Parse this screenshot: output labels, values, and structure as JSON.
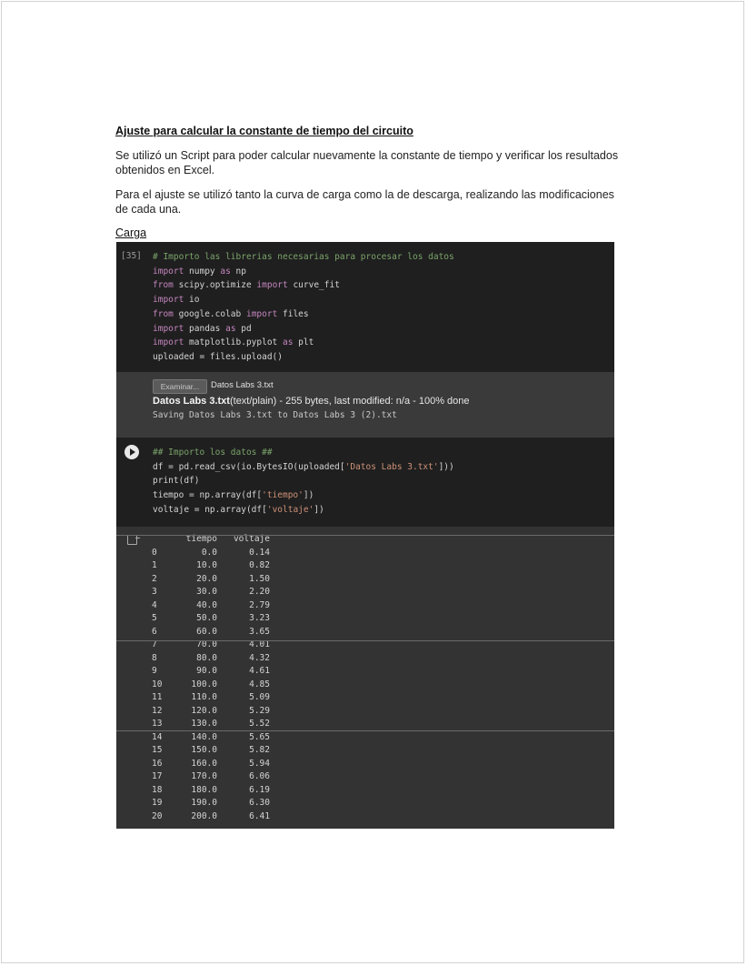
{
  "document": {
    "title": "Ajuste para calcular la constante de tiempo del circuito",
    "paragraph1": "Se utilizó un Script para poder calcular nuevamente la constante de tiempo y verificar los resultados obtenidos en Excel.",
    "paragraph2": "Para el ajuste se utilizó tanto la curva de carga como la de descarga, realizando las modificaciones de cada una.",
    "section_label": "Carga"
  },
  "notebook": {
    "cell1": {
      "execution_count": "[35]",
      "comment": "# Importo las librerias necesarias para procesar los datos",
      "lines": [
        "import numpy as np",
        "from scipy.optimize import curve_fit",
        "import io",
        "from google.colab import files",
        "import pandas as pd",
        "import matplotlib.pyplot as plt",
        "uploaded = files.upload()"
      ]
    },
    "upload_output": {
      "button_label": "Examinar...",
      "selected_file": "Datos Labs 3.txt",
      "status_name": "Datos Labs 3.txt",
      "status_detail": "(text/plain) - 255 bytes, last modified: n/a - 100% done",
      "saving_line": "Saving Datos Labs 3.txt to Datos Labs 3 (2).txt"
    },
    "cell2": {
      "comment": "## Importo los datos ##",
      "lines": [
        "df = pd.read_csv(io.BytesIO(uploaded['Datos Labs 3.txt']))",
        "print(df)",
        "tiempo = np.array(df['tiempo'])",
        "voltaje = np.array(df['voltaje'])"
      ]
    },
    "dataframe": {
      "columns": [
        "tiempo",
        "voltaje"
      ],
      "rows": [
        [
          "0",
          "0.0",
          "0.14"
        ],
        [
          "1",
          "10.0",
          "0.82"
        ],
        [
          "2",
          "20.0",
          "1.50"
        ],
        [
          "3",
          "30.0",
          "2.20"
        ],
        [
          "4",
          "40.0",
          "2.79"
        ],
        [
          "5",
          "50.0",
          "3.23"
        ],
        [
          "6",
          "60.0",
          "3.65"
        ],
        [
          "7",
          "70.0",
          "4.01"
        ],
        [
          "8",
          "80.0",
          "4.32"
        ],
        [
          "9",
          "90.0",
          "4.61"
        ],
        [
          "10",
          "100.0",
          "4.85"
        ],
        [
          "11",
          "110.0",
          "5.09"
        ],
        [
          "12",
          "120.0",
          "5.29"
        ],
        [
          "13",
          "130.0",
          "5.52"
        ],
        [
          "14",
          "140.0",
          "5.65"
        ],
        [
          "15",
          "150.0",
          "5.82"
        ],
        [
          "16",
          "160.0",
          "5.94"
        ],
        [
          "17",
          "170.0",
          "6.06"
        ],
        [
          "18",
          "180.0",
          "6.19"
        ],
        [
          "19",
          "190.0",
          "6.30"
        ],
        [
          "20",
          "200.0",
          "6.41"
        ]
      ]
    }
  }
}
